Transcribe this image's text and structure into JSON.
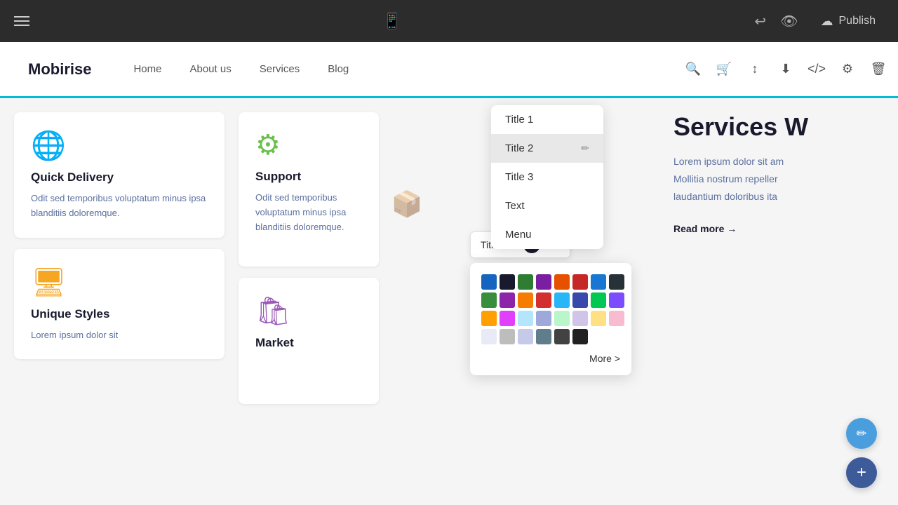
{
  "topbar": {
    "publish_label": "Publish",
    "mobile_icon": "📱"
  },
  "navbar": {
    "logo": "Mobirise",
    "links": [
      "Home",
      "About us",
      "Services",
      "Blog"
    ]
  },
  "toolbar": {
    "items": [
      "↕",
      "⬇",
      "</>",
      "⚙",
      "🗑"
    ]
  },
  "cards": [
    {
      "icon": "🌐",
      "title": "Quick Delivery",
      "text": "Odit sed temporibus voluptatum minus ipsa blanditiis doloremque."
    },
    {
      "icon": "⚙",
      "title": "Support",
      "text": "Odit sed temporibus voluptatum minus ipsa blanditiis doloremque."
    },
    {
      "icon": "🖥",
      "title": "Unique Styles",
      "text": "Lorem ipsum dolor sit"
    },
    {
      "icon": "🛍",
      "title": "Market",
      "text": ""
    }
  ],
  "dropdown": {
    "items": [
      "Title 1",
      "Title 2",
      "Title 3",
      "Text",
      "Menu"
    ],
    "selected": "Title 2",
    "format_label": "Title 2 ▾"
  },
  "color_picker": {
    "more_label": "More >",
    "colors": [
      "#1565C0",
      "#1a1a2e",
      "#2e7d32",
      "#7b1fa2",
      "#e65100",
      "#c62828",
      "#1976D2",
      "#263238",
      "#388e3c",
      "#8e24aa",
      "#f57c00",
      "#d32f2f",
      "#29b6f6",
      "#3949ab",
      "#00c853",
      "#7c4dff",
      "#ffa000",
      "#e040fb",
      "#b3e5fc",
      "#9fa8da",
      "#b9f6ca",
      "#d1c4e9",
      "#ffe082",
      "#f8bbd0",
      "#e8eaf6",
      "#bdbdbd",
      "#c5cae9",
      "#607d8b",
      "#424242",
      "#212121"
    ]
  },
  "services": {
    "title": "Services W",
    "text1": "Lorem ipsum dolor sit am",
    "text2": "Mollitia nostrum repeller",
    "text3": "laudantium doloribus ita",
    "read_more": "Read more →"
  }
}
